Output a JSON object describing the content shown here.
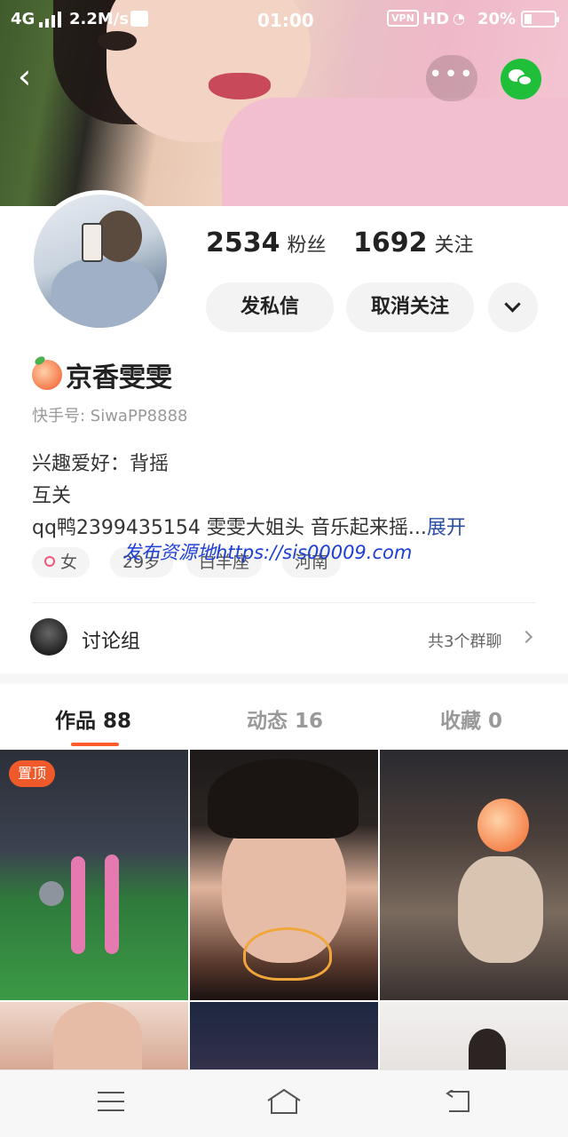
{
  "status_bar": {
    "network": "4G",
    "speed": "2.2M/s",
    "time": "01:00",
    "vpn": "VPN",
    "hd": "HD",
    "battery": "20%"
  },
  "profile": {
    "followers_count": "2534",
    "followers_label": "粉丝",
    "following_count": "1692",
    "following_label": "关注",
    "message_button": "发私信",
    "unfollow_button": "取消关注",
    "name": "京香雯雯",
    "user_id": "快手号: SiwaPP8888",
    "bio_line1": "兴趣爱好：背摇",
    "bio_line2": "互关",
    "bio_line3": "qq鸭2399435154 雯雯大姐头 音乐起来摇...",
    "bio_expand": "展开",
    "tags": {
      "gender": "女",
      "age": "29岁",
      "zodiac": "白羊座",
      "location": "河南"
    }
  },
  "watermark": "发布资源地https://sis00009.com",
  "group": {
    "label": "讨论组",
    "count": "共3个群聊"
  },
  "tabs": [
    {
      "label": "作品 88"
    },
    {
      "label": "动态 16"
    },
    {
      "label": "收藏 0"
    }
  ],
  "grid": {
    "pinned_label": "置顶"
  },
  "colors": {
    "accent": "#fe5c2c",
    "wechat": "#1fbf3a",
    "link": "#2b4ea5",
    "watermark": "#1d3fd6"
  },
  "icons": {
    "back": "chevron-left-icon",
    "more": "more-dots-icon",
    "share_wechat": "wechat-icon",
    "dropdown": "chevron-down-icon",
    "gender": "female-icon",
    "group_arrow": "chevron-right-icon",
    "nav_menu": "menu-icon",
    "nav_home": "home-icon",
    "nav_back": "back-icon"
  }
}
